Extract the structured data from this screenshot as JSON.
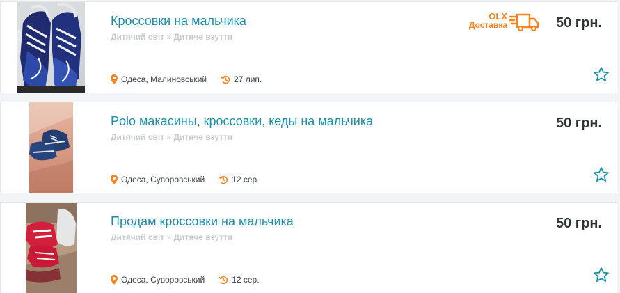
{
  "listings": [
    {
      "title": "Кроссовки на мальчика",
      "category": "Дитячий світ » Дитяче взуття",
      "location": "Одеса, Малиновський",
      "date": "27 лип.",
      "price": "50 грн.",
      "delivery": {
        "line1": "OLX",
        "line2": "Доставка"
      },
      "image": "photo-sneakers-blue-black-white-laces"
    },
    {
      "title": "Polo макасины, кроссовки, кеды на мальчика",
      "category": "Дитячий світ » Дитяче взуття",
      "location": "Одеса, Суворовський",
      "date": "12 сер.",
      "price": "50 грн.",
      "image": "photo-blue-sneakers-on-floor"
    },
    {
      "title": "Продам кроссовки на мальчика",
      "category": "Дитячий світ » Дитяче взуття",
      "location": "Одеса, Суворовський",
      "date": "12 сер.",
      "price": "50 грн.",
      "image": "photo-red-white-sneakers"
    }
  ],
  "colors": {
    "link": "#1b8fa8",
    "muted": "#c7ccd0",
    "accent": "#f6831f",
    "star": "#1b8fa8",
    "price": "#2f3537"
  },
  "icons": {
    "location": "location-pin-icon",
    "date": "clock-icon",
    "favorite": "star-icon",
    "delivery": "delivery-truck-icon"
  }
}
